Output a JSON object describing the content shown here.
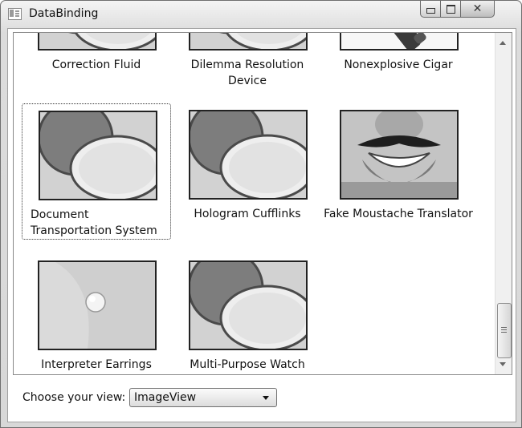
{
  "window": {
    "title": "DataBinding"
  },
  "products": [
    {
      "name": "Correction Fluid",
      "image": "compact"
    },
    {
      "name": "Dilemma Resolution Device",
      "image": "compact"
    },
    {
      "name": "Nonexplosive Cigar",
      "image": "cigar"
    },
    {
      "name": "Document Transportation System",
      "image": "compact"
    },
    {
      "name": "Hologram Cufflinks",
      "image": "compact"
    },
    {
      "name": "Fake Moustache Translator",
      "image": "moustache"
    },
    {
      "name": "Interpreter Earrings",
      "image": "earring"
    },
    {
      "name": "Multi-Purpose Watch",
      "image": "compact"
    }
  ],
  "view": {
    "label": "Choose your view:",
    "selected": "ImageView"
  }
}
